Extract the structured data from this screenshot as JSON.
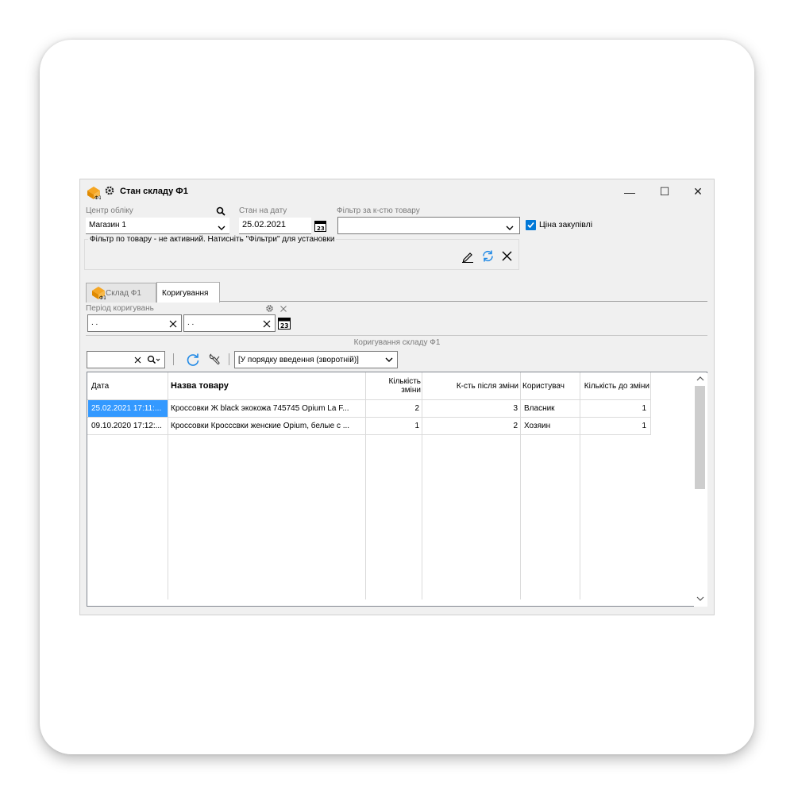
{
  "window": {
    "title": "Стан складу Ф1",
    "minimize": "—",
    "maximize": "☐",
    "close": "✕"
  },
  "filters": {
    "center_label": "Центр обліку",
    "center_value": "Магазин 1",
    "date_label": "Стан на дату",
    "date_value": "25.02.2021",
    "qty_filter_label": "Фільтр за к-стю товару",
    "qty_filter_value": "",
    "purchase_price_label": "Ціна закупівлі",
    "purchase_price_checked": true,
    "product_filter_caption": "Фільтр по товару - не активний. Натисніть \"Фільтри\" для установки"
  },
  "tabs": [
    {
      "label": "Склад Ф1",
      "active": false
    },
    {
      "label": "Коригування",
      "active": true
    }
  ],
  "period": {
    "label": "Період коригувань",
    "from_value": " . .",
    "to_value": " . ."
  },
  "section_title": "Коригування складу Ф1",
  "toolbar": {
    "search_value": "",
    "sort_value": "[У порядку введення (зворотній)]"
  },
  "table": {
    "columns": [
      "Дата",
      "Назва товару",
      "Кількість зміни",
      "К-сть після зміни",
      "Користувач",
      "Кількість до зміни"
    ],
    "rows": [
      {
        "date": "25.02.2021 17:11:...",
        "name": "Кроссовки Ж black экокожа 745745 Opium La F...",
        "change": "2",
        "after": "3",
        "user": "Власник",
        "before": "1",
        "selected": true
      },
      {
        "date": "09.10.2020 17:12:...",
        "name": "Кроссовки Кросссвки женские Opium, белые с ...",
        "change": "1",
        "after": "2",
        "user": "Хозяин",
        "before": "1",
        "selected": false
      }
    ]
  },
  "colors": {
    "selection": "#3399ff",
    "checkbox": "#0078d7",
    "refresh": "#1e88e5",
    "icon_orange": "#f5a623"
  }
}
